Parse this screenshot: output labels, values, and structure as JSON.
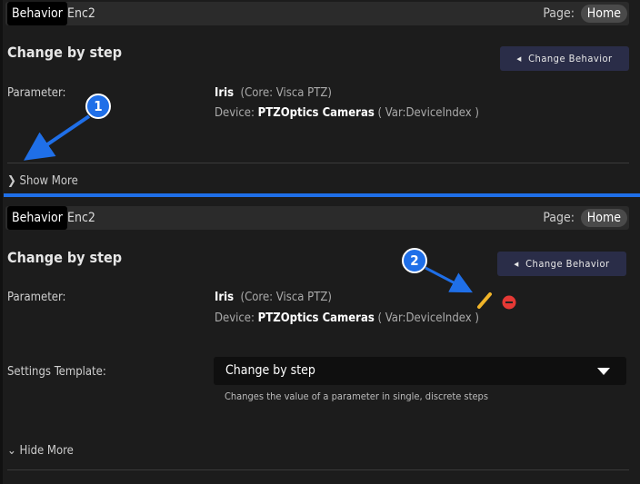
{
  "panels": [
    {
      "tabs": {
        "active": "Behavior",
        "second": "Enc2"
      },
      "page_label": "Page:",
      "page_value": "Home",
      "title": "Change by step",
      "change_button": "Change Behavior",
      "parameter_label": "Parameter:",
      "param_name": "Iris",
      "param_core": "(Core: Visca PTZ)",
      "device_prefix": "Device:",
      "device_name": "PTZOptics Cameras",
      "device_var": "( Var:DeviceIndex )",
      "toggle": "Show More"
    },
    {
      "tabs": {
        "active": "Behavior",
        "second": "Enc2"
      },
      "page_label": "Page:",
      "page_value": "Home",
      "title": "Change by step",
      "change_button": "Change Behavior",
      "parameter_label": "Parameter:",
      "param_name": "Iris",
      "param_core": "(Core: Visca PTZ)",
      "device_prefix": "Device:",
      "device_name": "PTZOptics Cameras",
      "device_var": "( Var:DeviceIndex )",
      "settings_label": "Settings Template:",
      "settings_value": "Change by step",
      "settings_help": "Changes the value of a parameter in single, discrete steps",
      "toggle": "Hide More"
    }
  ],
  "annotations": [
    "1",
    "2"
  ],
  "colors": {
    "accent": "#1f6fe8",
    "button_bg": "#2a2d48",
    "edit": "#f0b429",
    "delete": "#e53935"
  },
  "icons": {
    "edit": "pencil-icon",
    "delete": "minus-circle-icon",
    "show": "chevron-right-icon",
    "hide": "chevron-down-icon"
  }
}
